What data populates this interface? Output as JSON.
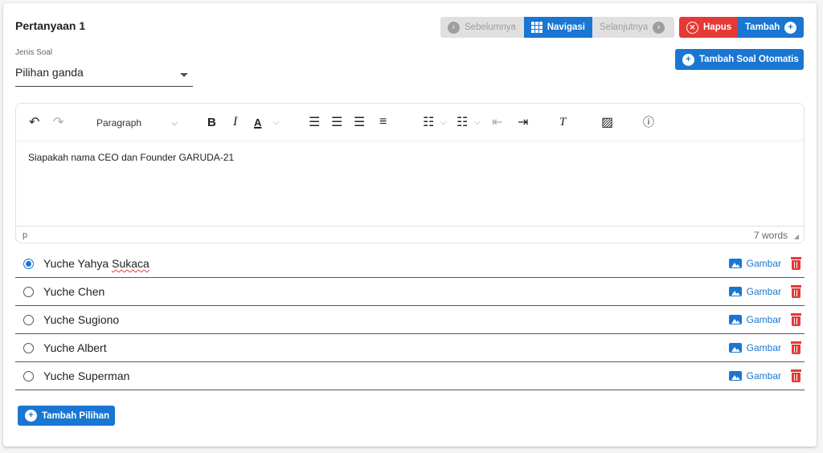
{
  "question": {
    "title": "Pertanyaan 1"
  },
  "nav_buttons": {
    "prev_label": "Sebelumnya",
    "nav_label": "Navigasi",
    "next_label": "Selanjutnya",
    "delete_label": "Hapus",
    "add_label": "Tambah",
    "auto_label": "Tambah Soal Otomatis"
  },
  "type_field": {
    "label": "Jenis Soal",
    "value": "Pilihan ganda"
  },
  "editor": {
    "block_format": "Paragraph",
    "content": "Siapakah nama CEO dan Founder GARUDA-21",
    "status_path": "p",
    "word_count": "7 words"
  },
  "options": [
    {
      "text": "Yuche Yahya Sukaca",
      "text_main": "Yuche Yahya ",
      "text_flagged": "Sukaca",
      "selected": true,
      "image_label": "Gambar"
    },
    {
      "text": "Yuche Chen",
      "selected": false,
      "image_label": "Gambar"
    },
    {
      "text": "Yuche Sugiono",
      "selected": false,
      "image_label": "Gambar"
    },
    {
      "text": "Yuche Albert",
      "selected": false,
      "image_label": "Gambar"
    },
    {
      "text": "Yuche Superman",
      "selected": false,
      "image_label": "Gambar"
    }
  ],
  "add_option_label": "Tambah Pilihan",
  "colors": {
    "primary": "#1976d2",
    "danger": "#e53935",
    "disabled": "#e0e0e0"
  }
}
